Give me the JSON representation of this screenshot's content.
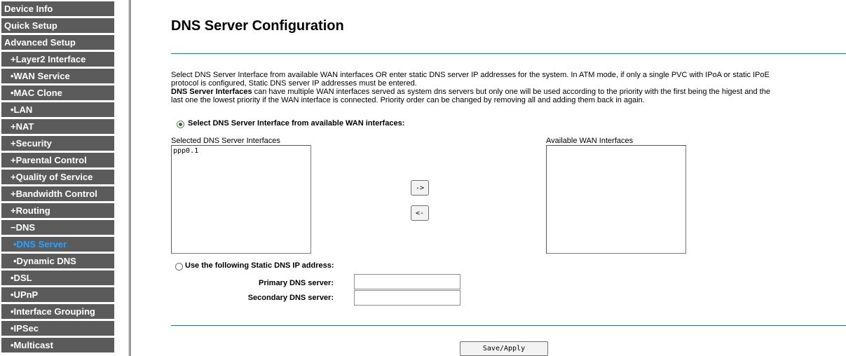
{
  "sidebar": {
    "items": [
      {
        "label": "Device Info"
      },
      {
        "label": "Quick Setup"
      },
      {
        "label": "Advanced Setup"
      },
      {
        "label": "+Layer2 Interface"
      },
      {
        "label": "•WAN Service"
      },
      {
        "label": "•MAC Clone"
      },
      {
        "label": "•LAN"
      },
      {
        "label": "+NAT"
      },
      {
        "label": "+Security"
      },
      {
        "label": "+Parental Control"
      },
      {
        "label": "+Quality of Service"
      },
      {
        "label": "+Bandwidth Control"
      },
      {
        "label": "+Routing"
      },
      {
        "label": "−DNS"
      },
      {
        "label": "•DNS Server"
      },
      {
        "label": "•Dynamic DNS"
      },
      {
        "label": "•DSL"
      },
      {
        "label": "•UPnP"
      },
      {
        "label": "•Interface Grouping"
      },
      {
        "label": "•IPSec"
      },
      {
        "label": "•Multicast"
      }
    ],
    "active_label": "•DNS Server",
    "bg_color": "#5b5b5b",
    "active_color": "#29a3ff"
  },
  "main": {
    "title": "DNS Server Configuration",
    "description": {
      "line1": "Select DNS Server Interface from available WAN interfaces OR enter static DNS server IP addresses for the system. In ATM mode, if only a single PVC with IPoA or static IPoE",
      "line2": "protocol is configured, Static DNS server IP addresses must be entered.",
      "bold_term": "DNS Server Interfaces",
      "line3_rest": " can have multiple WAN interfaces served as system dns servers but only one will be used according to the priority with the first being the higest and the",
      "line4": "last one the lowest priority if the WAN interface is connected. Priority order can be changed by removing all and adding them back in again."
    },
    "option_wan_label": "Select DNS Server Interface from available WAN interfaces:",
    "selected_list_label": "Selected DNS Server Interfaces",
    "selected_list_items": [
      "ppp0.1"
    ],
    "available_list_label": "Available WAN Interfaces",
    "available_list_items": [],
    "move_right_label": "->",
    "move_left_label": "<-",
    "option_static_label": "Use the following Static DNS IP address:",
    "primary_dns_label": "Primary DNS server:",
    "primary_dns_value": "",
    "secondary_dns_label": "Secondary DNS server:",
    "secondary_dns_value": "",
    "save_label": "Save/Apply",
    "selected_option": "wan"
  }
}
